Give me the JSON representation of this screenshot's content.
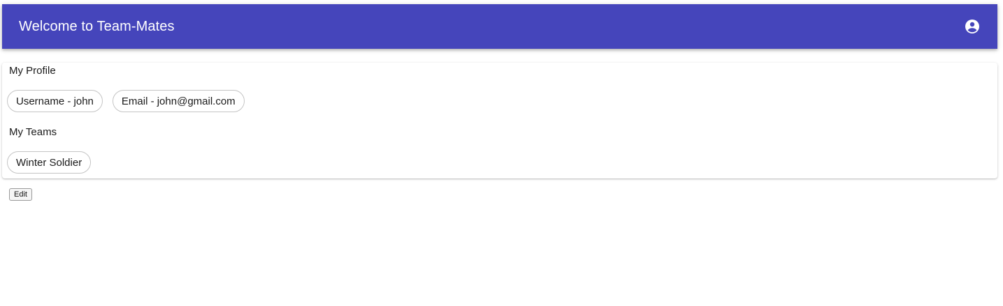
{
  "app_bar": {
    "title": "Welcome to Team-Mates",
    "account_icon": "account-circle-icon",
    "background_color": "#4545bb"
  },
  "profile": {
    "heading": "My Profile",
    "chips": [
      "Username - john",
      "Email - john@gmail.com"
    ]
  },
  "teams": {
    "heading": "My Teams",
    "chips": [
      "Winter Soldier"
    ]
  },
  "actions": {
    "edit_label": "Edit"
  }
}
